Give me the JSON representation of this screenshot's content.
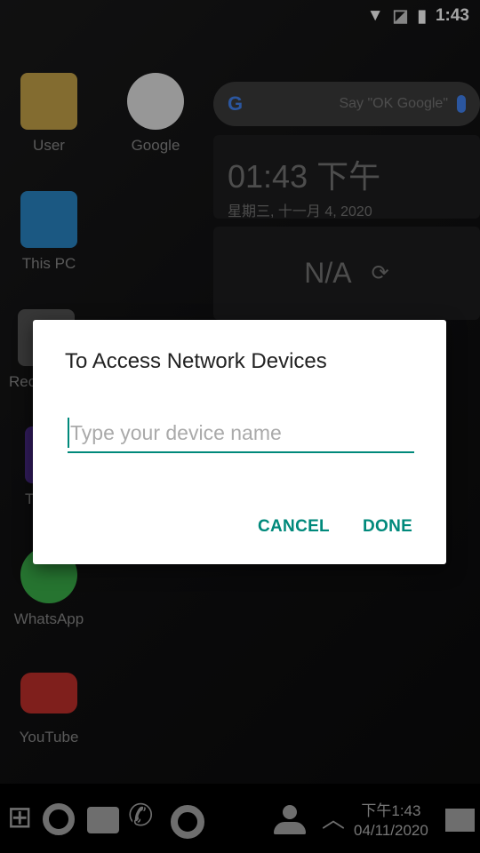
{
  "status_bar": {
    "time": "1:43",
    "icons": [
      "wifi-icon",
      "no-sim-icon",
      "battery-charging-icon"
    ]
  },
  "desktop": {
    "icons": [
      {
        "label": "User",
        "icon": "user-folder-icon"
      },
      {
        "label": "Google",
        "icon": "google-icon"
      },
      {
        "label": "This PC",
        "icon": "computer-icon"
      },
      {
        "label": "Rec",
        "icon": "recycle-bin-icon"
      },
      {
        "label": "T",
        "icon": "app-icon"
      },
      {
        "label": "WhatsApp",
        "icon": "whatsapp-icon"
      },
      {
        "label": "YouTube",
        "icon": "youtube-icon"
      }
    ]
  },
  "search_widget": {
    "placeholder": "Say \"OK Google\"",
    "logo": "G"
  },
  "clock_widget": {
    "time": "01:43 下午",
    "date": "星期三, 十一月 4, 2020"
  },
  "weather_widget": {
    "value": "N/A",
    "refresh": "⟳"
  },
  "dialog": {
    "title": "To Access Network Devices",
    "input_placeholder": "Type your device name",
    "input_value": "",
    "cancel": "CANCEL",
    "done": "DONE"
  },
  "taskbar": {
    "time": "下午1:43",
    "date": "04/11/2020"
  },
  "colors": {
    "accent": "#00897b"
  }
}
